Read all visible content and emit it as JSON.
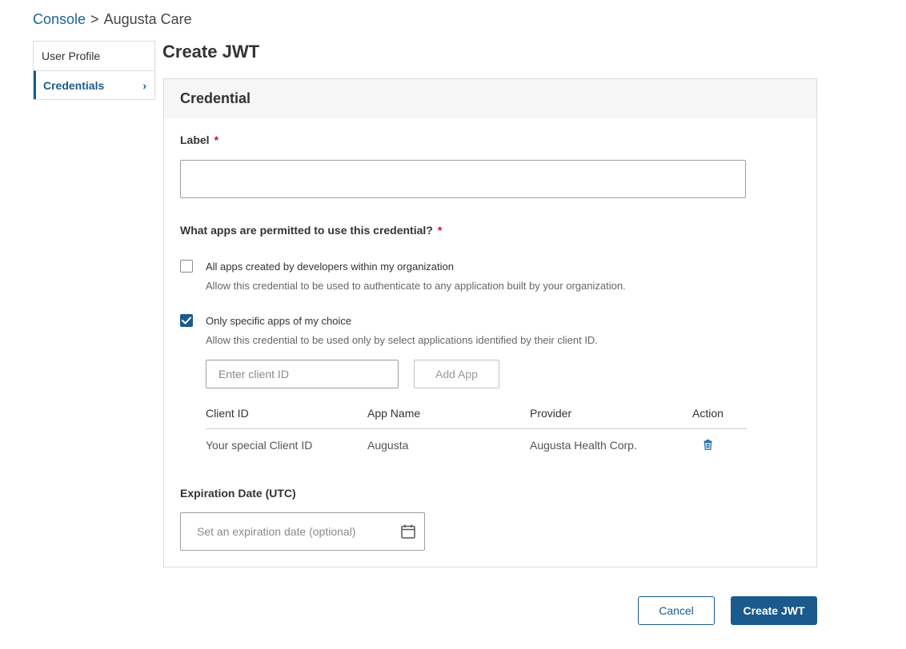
{
  "breadcrumb": {
    "root": "Console",
    "separator": ">",
    "current": "Augusta Care"
  },
  "sidebar": {
    "items": [
      {
        "label": "User Profile",
        "active": false
      },
      {
        "label": "Credentials",
        "active": true,
        "chevron": "›"
      }
    ]
  },
  "page": {
    "title": "Create JWT"
  },
  "panel": {
    "header": "Credential",
    "label_field": {
      "label": "Label",
      "required_mark": "*",
      "value": "",
      "placeholder": ""
    },
    "apps_question": {
      "label": "What apps are permitted to use this credential?",
      "required_mark": "*"
    },
    "options": [
      {
        "title": "All apps created by developers within my organization",
        "description": "Allow this credential to be used to authenticate to any application built by your organization.",
        "checked": false
      },
      {
        "title": "Only specific apps of my choice",
        "description": "Allow this credential to be used only by select applications identified by their client ID.",
        "checked": true
      }
    ],
    "client_input": {
      "placeholder": "Enter client ID",
      "value": ""
    },
    "add_app_label": "Add App",
    "table": {
      "headers": [
        "Client ID",
        "App Name",
        "Provider",
        "Action"
      ],
      "rows": [
        {
          "client_id": "Your special Client ID",
          "app_name": "Augusta",
          "provider": "Augusta Health Corp.",
          "action_icon": "trash-icon"
        }
      ]
    },
    "expiration": {
      "label": "Expiration Date (UTC)",
      "placeholder": "Set an expiration date (optional)",
      "icon": "calendar-icon"
    }
  },
  "actions": {
    "cancel_label": "Cancel",
    "submit_label": "Create JWT"
  },
  "colors": {
    "accent": "#1a5a8c",
    "link": "#1a6496",
    "required": "#c8102e"
  }
}
